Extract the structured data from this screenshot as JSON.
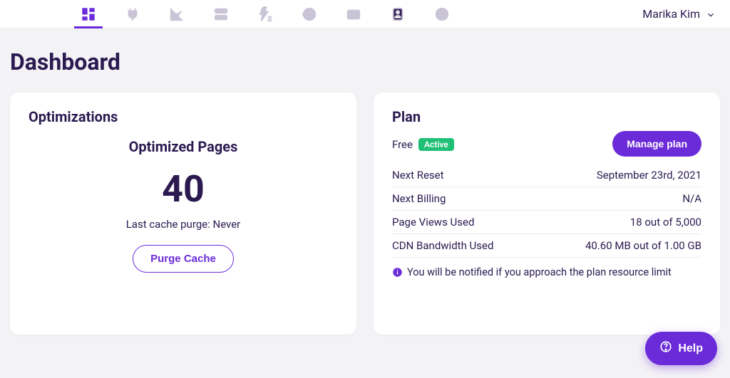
{
  "nav": {
    "user_name": "Marika Kim"
  },
  "page": {
    "title": "Dashboard"
  },
  "optimizations": {
    "title": "Optimizations",
    "subtitle": "Optimized Pages",
    "count": "40",
    "last_purge_label": "Last cache purge: Never",
    "purge_button": "Purge Cache"
  },
  "plan": {
    "title": "Plan",
    "name": "Free",
    "status": "Active",
    "manage_button": "Manage plan",
    "rows": [
      {
        "label": "Next Reset",
        "value": "September 23rd, 2021"
      },
      {
        "label": "Next Billing",
        "value": "N/A"
      },
      {
        "label": "Page Views Used",
        "value": "18 out of 5,000"
      },
      {
        "label": "CDN Bandwidth Used",
        "value": "40.60 MB out of 1.00 GB"
      }
    ],
    "notice": "You will be notified if you approach the plan resource limit"
  },
  "help": {
    "label": "Help"
  }
}
